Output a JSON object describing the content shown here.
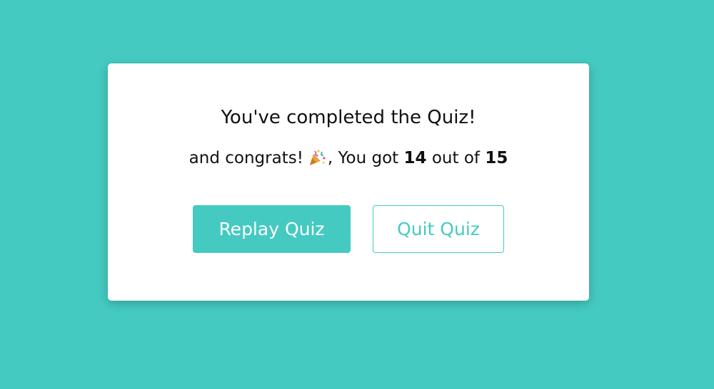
{
  "colors": {
    "background": "#44cac1",
    "accent": "#44cac1",
    "card": "#ffffff",
    "text": "#111111"
  },
  "result": {
    "title": "You've completed the Quiz!",
    "score_prefix": "and congrats!",
    "score_icon": "party-popper-icon",
    "score_middle": ", You got",
    "score": "14",
    "score_between": "out of",
    "total": "15"
  },
  "buttons": {
    "replay_label": "Replay Quiz",
    "quit_label": "Quit Quiz"
  }
}
